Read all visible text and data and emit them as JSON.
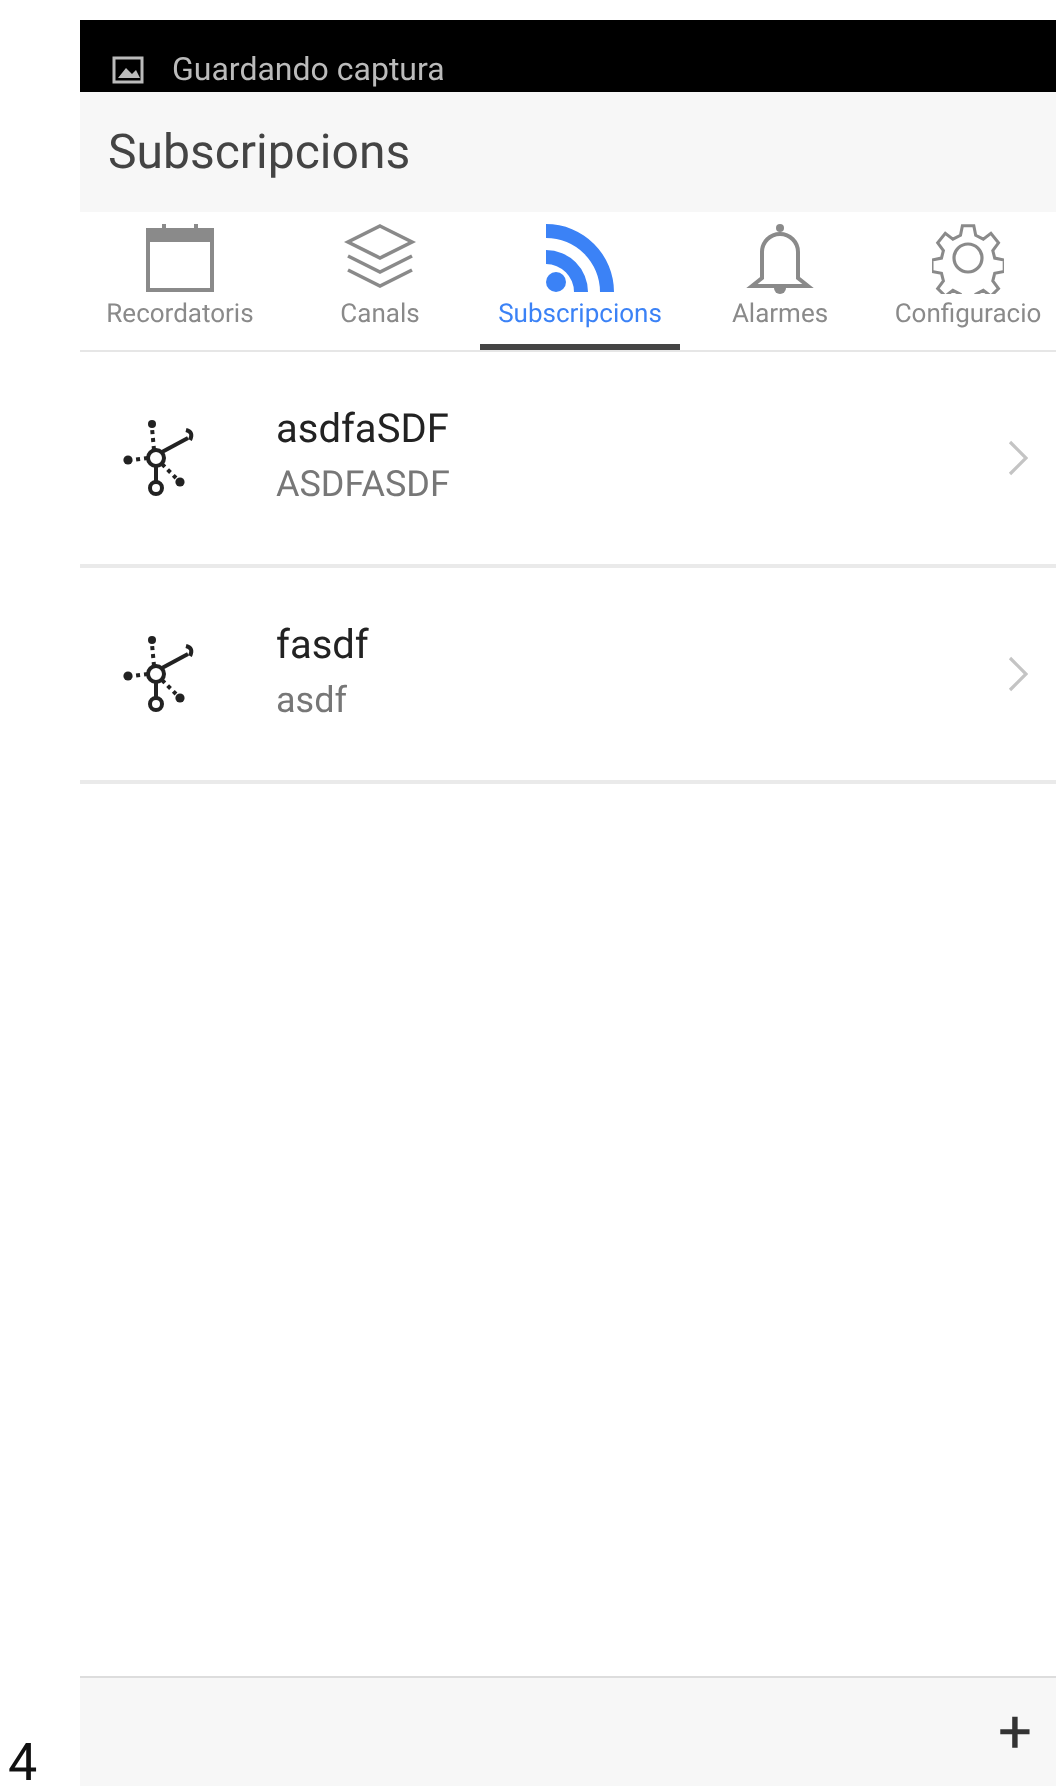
{
  "status_bar": {
    "notification": "Guardando captura"
  },
  "app_bar": {
    "title": "Subscripcions"
  },
  "tabs": [
    {
      "label": "Recordatoris",
      "kind": "calendar",
      "selected": false
    },
    {
      "label": "Canals",
      "kind": "layers",
      "selected": false
    },
    {
      "label": "Subscripcions",
      "kind": "feed",
      "selected": true
    },
    {
      "label": "Alarmes",
      "kind": "bell",
      "selected": false
    },
    {
      "label": "Configuracio",
      "kind": "gear",
      "selected": false
    }
  ],
  "subscriptions": [
    {
      "title": "asdfaSDF",
      "subtitle": "ASDFASDF"
    },
    {
      "title": "fasdf",
      "subtitle": "asdf"
    }
  ],
  "bottom_bar": {
    "add_button": "+"
  },
  "outside_text": "4"
}
